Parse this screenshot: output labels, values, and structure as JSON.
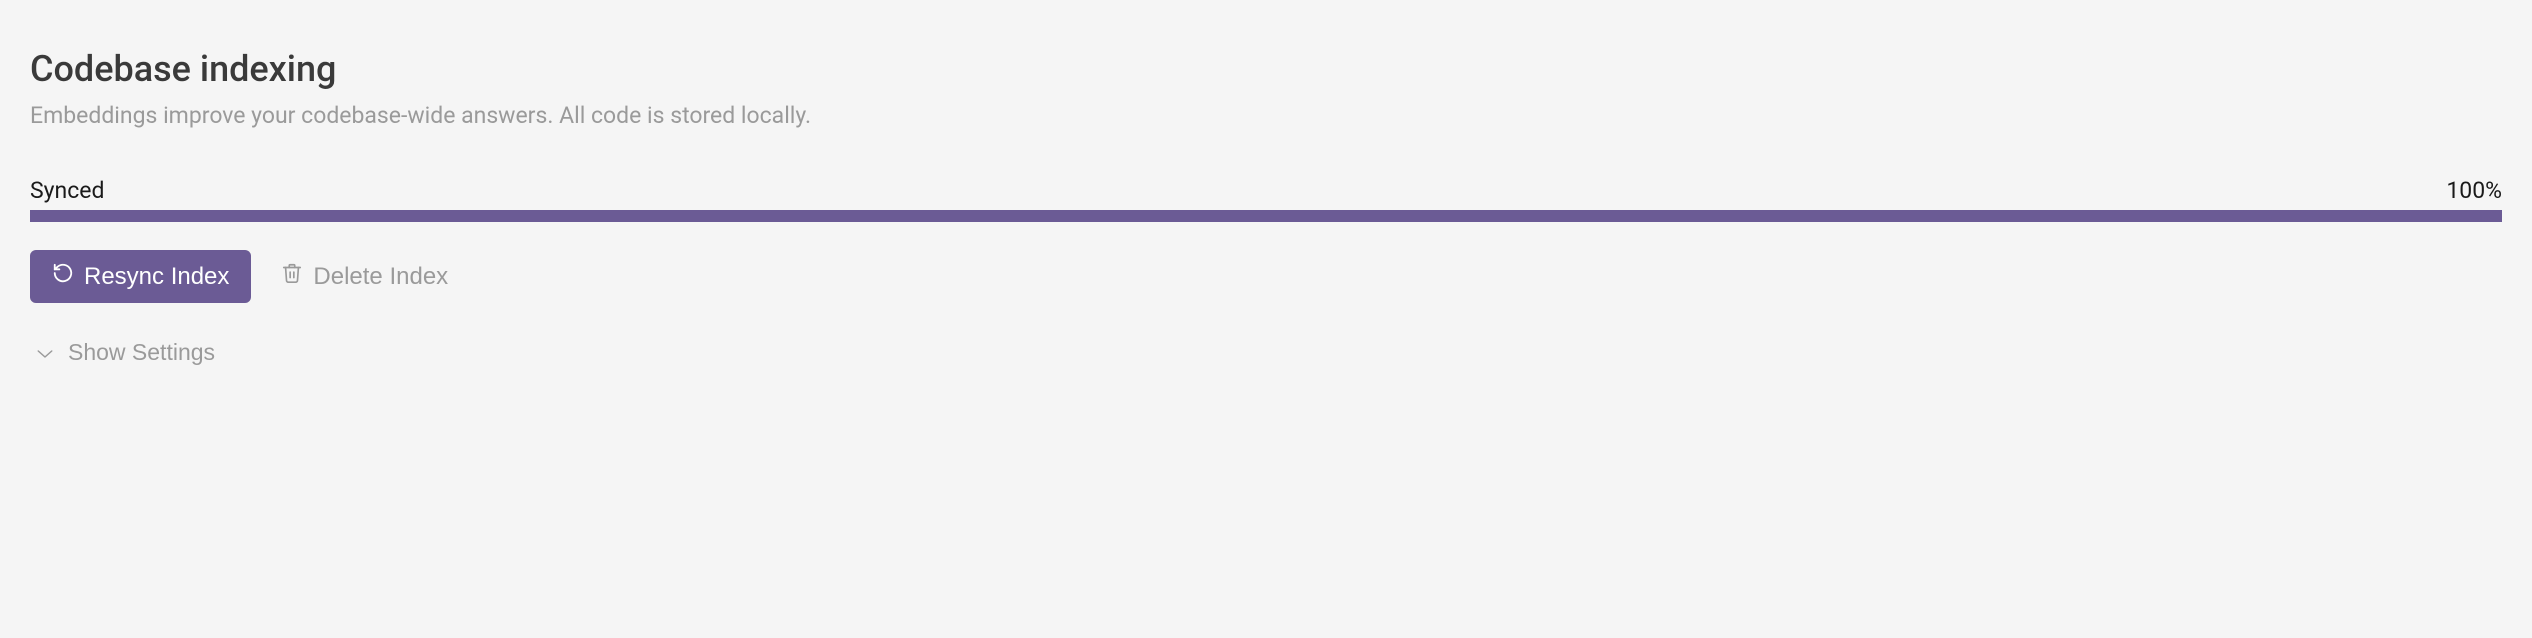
{
  "header": {
    "title": "Codebase indexing",
    "subtitle": "Embeddings improve your codebase-wide answers. All code is stored locally."
  },
  "status": {
    "label": "Synced",
    "percent_text": "100%",
    "percent_value": 100
  },
  "actions": {
    "resync_label": "Resync Index",
    "delete_label": "Delete Index"
  },
  "settings": {
    "toggle_label": "Show Settings"
  },
  "colors": {
    "accent": "#6b5b95"
  }
}
